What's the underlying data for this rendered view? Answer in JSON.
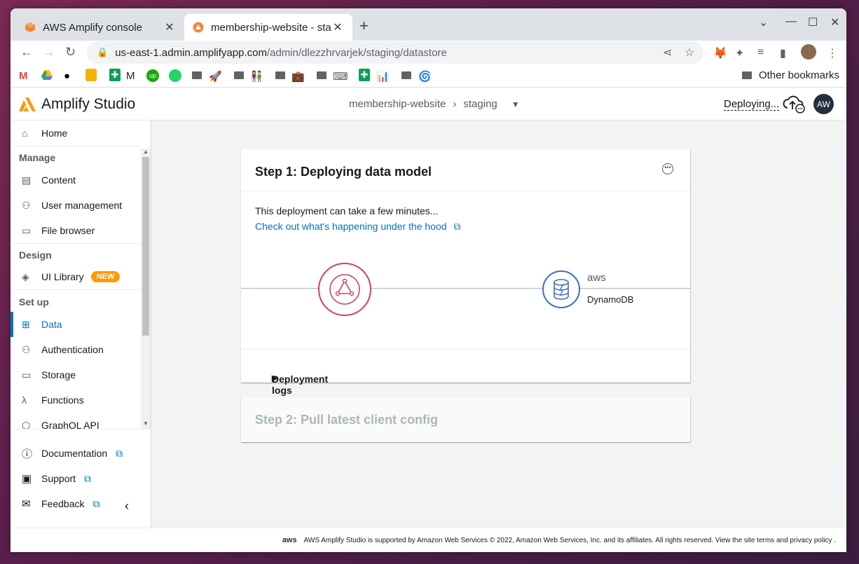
{
  "browser": {
    "tabs": [
      {
        "title": "AWS Amplify console",
        "close": "✕"
      },
      {
        "title": "membership-website - sta",
        "close": "✕"
      }
    ],
    "new_tab": "+",
    "url_host": "us-east-1.admin.amplifyapp.com",
    "url_path": "/admin/dlezzhrvarjek/staging/datastore",
    "bookmarks_m_label": "M",
    "other_bookmarks": "Other bookmarks"
  },
  "app": {
    "name": "Amplify Studio",
    "breadcrumb": [
      "membership-website",
      "staging"
    ],
    "deploying_label": "Deploying...",
    "avatar_initials": "AW"
  },
  "sidebar": {
    "home": "Home",
    "sections": {
      "manage": "Manage",
      "design": "Design",
      "setup": "Set up"
    },
    "items": {
      "content": "Content",
      "user_management": "User management",
      "file_browser": "File browser",
      "ui_library": "UI Library",
      "new_badge": "NEW",
      "data": "Data",
      "authentication": "Authentication",
      "storage": "Storage",
      "functions": "Functions",
      "graphql_api": "GraphQL API"
    },
    "bottom": {
      "documentation": "Documentation",
      "support": "Support",
      "feedback": "Feedback"
    }
  },
  "step1": {
    "title": "Step 1: Deploying data model",
    "desc": "This deployment can take a few minutes...",
    "link": "Check out what's happening under the hood",
    "aws": "aws",
    "service": "DynamoDB",
    "logs": "Deployment logs"
  },
  "step2": {
    "title": "Step 2: Pull latest client config"
  },
  "footer": {
    "aws_logo": "aws",
    "text": "AWS Amplify Studio is supported by Amazon Web Services © 2022, Amazon Web Services, Inc. and its affiliates. All rights reserved. View the site terms and privacy policy ."
  },
  "colors": {
    "accent": "#0073bb",
    "amplify_orange": "#ff9900",
    "appsync_pink": "#d13f6a",
    "dynamodb_blue": "#3b6fc2"
  }
}
